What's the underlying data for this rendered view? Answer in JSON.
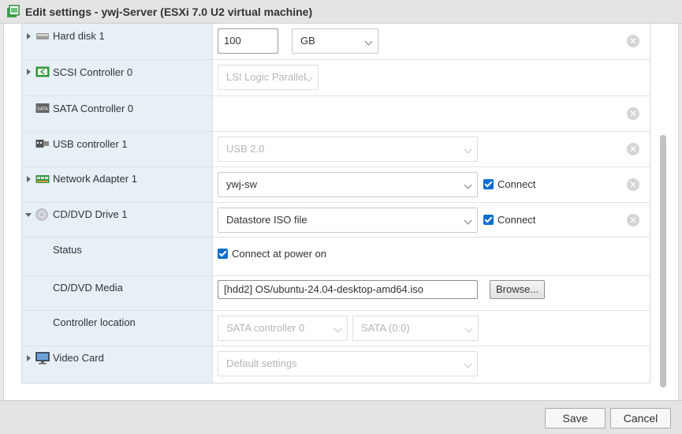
{
  "dialog": {
    "title": "Edit settings - ywj-Server (ESXi 7.0 U2 virtual machine)"
  },
  "rows": {
    "hard_disk": {
      "label": "Hard disk 1",
      "size_value": "100",
      "unit": "GB",
      "icon": "disk-icon"
    },
    "scsi": {
      "label": "SCSI Controller 0",
      "type": "LSI Logic Parallel",
      "icon": "scsi-controller-icon"
    },
    "sata": {
      "label": "SATA Controller 0",
      "icon": "sata-icon"
    },
    "usb": {
      "label": "USB controller 1",
      "version": "USB 2.0",
      "icon": "usb-icon"
    },
    "network": {
      "label": "Network Adapter 1",
      "network": "ywj-sw",
      "connect_label": "Connect",
      "connected": true,
      "icon": "network-adapter-icon"
    },
    "cdrom": {
      "label": "CD/DVD Drive 1",
      "source": "Datastore ISO file",
      "connect_label": "Connect",
      "connected": true,
      "icon": "cd-dvd-icon"
    },
    "status": {
      "label": "Status",
      "power_on_label": "Connect at power on",
      "power_on_checked": true
    },
    "media": {
      "label": "CD/DVD Media",
      "path": "[hdd2] OS/ubuntu-24.04-desktop-amd64.iso",
      "browse_label": "Browse..."
    },
    "controller_location": {
      "label": "Controller location",
      "controller": "SATA controller 0",
      "slot": "SATA (0:0)"
    },
    "video": {
      "label": "Video Card",
      "setting": "Default settings",
      "icon": "monitor-icon"
    }
  },
  "footer": {
    "save_label": "Save",
    "cancel_label": "Cancel"
  },
  "colors": {
    "accent": "#0f6ecd",
    "label_bg": "#e7f0f7",
    "icon_green": "#2e9a3c"
  }
}
